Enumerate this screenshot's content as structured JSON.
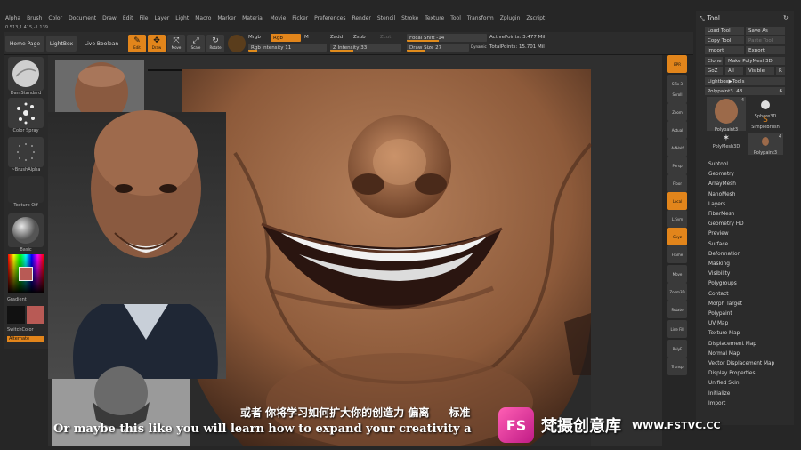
{
  "menu": [
    "Alpha",
    "Brush",
    "Color",
    "Document",
    "Draw",
    "Edit",
    "File",
    "Layer",
    "Light",
    "Macro",
    "Marker",
    "Material",
    "Movie",
    "Picker",
    "Preferences",
    "Render",
    "Stencil",
    "Stroke",
    "Texture",
    "Tool",
    "Transform",
    "Zplugin",
    "Zscript"
  ],
  "coords": "0.513,1.415,-1.139",
  "shelf": {
    "home_page": "Home Page",
    "lightbox": "LightBox",
    "live_boolean": "Live Boolean",
    "edit": "Edit",
    "draw": "Draw",
    "move": "Move",
    "scale": "Scale",
    "rotate": "Rotate",
    "mrgb": "Mrgb",
    "rgb": "Rgb",
    "m": "M",
    "rgb_intensity": "Rgb Intensity 11",
    "zadd": "Zadd",
    "zsub": "Zsub",
    "zcut": "Zcut",
    "z_intensity": "Z Intensity 33",
    "focal_shift": "Focal Shift -14",
    "draw_size": "Draw Size 27",
    "dynamic": "Dynamic",
    "active_points": "ActivePoints: 3.477 Mil",
    "total_points": "TotalPoints: 15.701 Mil",
    "rgb_intensity_level": 0.11,
    "z_intensity_level": 0.33
  },
  "left_tray": {
    "brush": "DamStandard",
    "stroke": "Color Spray",
    "alpha": "~BrushAlpha",
    "texture": "Texture Off",
    "material": "Basic",
    "gradient": "Gradient",
    "switch_color": "SwitchColor",
    "alternate": "Alternate",
    "color_main": "#111111",
    "color_secondary": "#b85a55"
  },
  "right_toolbar": [
    "BPR",
    "SPix 3",
    "Scroll",
    "Zoom",
    "Actual",
    "AAHalf",
    "Persp",
    "Floor",
    "Local",
    "L.Sym",
    "Gxyz",
    "Frame",
    "Move",
    "Zoom3D",
    "Rotate",
    "Line Fill",
    "PolyF",
    "Transp",
    "Ghost",
    "Solo",
    "Xpose"
  ],
  "tool_panel": {
    "title": "Tool",
    "load_tool": "Load Tool",
    "save_as": "Save As",
    "copy_tool": "Copy Tool",
    "paste_tool": "Paste Tool",
    "import": "Import",
    "export": "Export",
    "clone": "Clone",
    "make_polymesh": "Make PolyMesh3D",
    "goz": "GoZ",
    "all": "All",
    "visible": "Visible",
    "r": "R",
    "lightbox_tools": "Lightbox▶Tools",
    "current_tool": "Polypaint3. 48",
    "current_tool_count": "6",
    "tools": [
      {
        "name": "Polypaint3",
        "count": "4"
      },
      {
        "name": "Sphere3D",
        "count": ""
      },
      {
        "name": "SimpleBrush",
        "count": ""
      },
      {
        "name": "PolyMesh3D",
        "count": ""
      },
      {
        "name": "Polypaint3",
        "count": "4"
      }
    ],
    "subpalettes": [
      "Subtool",
      "Geometry",
      "ArrayMesh",
      "NanoMesh",
      "Layers",
      "FiberMesh",
      "Geometry HD",
      "Preview",
      "Surface",
      "Deformation",
      "Masking",
      "Visibility",
      "Polygroups",
      "Contact",
      "Morph Target",
      "Polypaint",
      "UV Map",
      "Texture Map",
      "Displacement Map",
      "Normal Map",
      "Vector Displacement Map",
      "Display Properties",
      "Unified Skin",
      "Initialize",
      "Import"
    ]
  },
  "subtitles": {
    "cn": "或者 你将学习如何扩大你的创造力 偏离",
    "cn_tail": "标准",
    "en": "Or maybe this like you will learn how to expand your creativity a"
  },
  "watermark": {
    "logo": "FS",
    "name": "梵摄创意库",
    "url": "WWW.FSTVC.CC"
  }
}
